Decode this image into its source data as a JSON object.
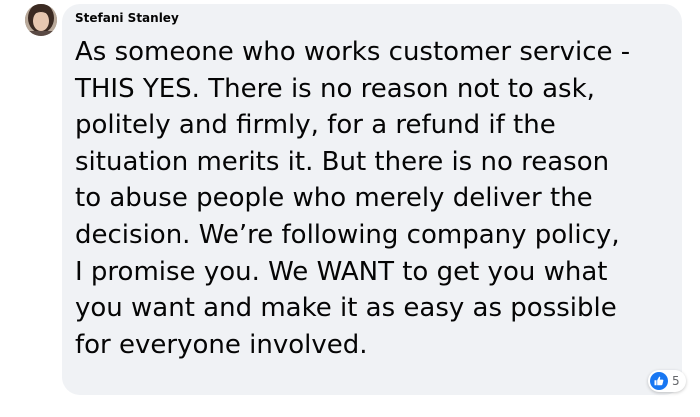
{
  "comment": {
    "author": "Stefani Stanley",
    "text": "As someone who works customer service -\nTHIS YES. There is no reason not to ask,\npolitely and firmly, for a refund if the\nsituation merits it. But there is no reason\nto abuse people who merely deliver the\ndecision. We’re following company policy,\nI promise you. We WANT to get you what\nyou want and make it as easy as possible\nfor everyone involved."
  },
  "reactions": {
    "icon": "like-icon",
    "count": "5",
    "color": "#1877f2"
  },
  "colors": {
    "bubble_bg": "#f0f2f5",
    "text": "#050505",
    "secondary_text": "#65676b",
    "like_blue": "#1877f2"
  }
}
